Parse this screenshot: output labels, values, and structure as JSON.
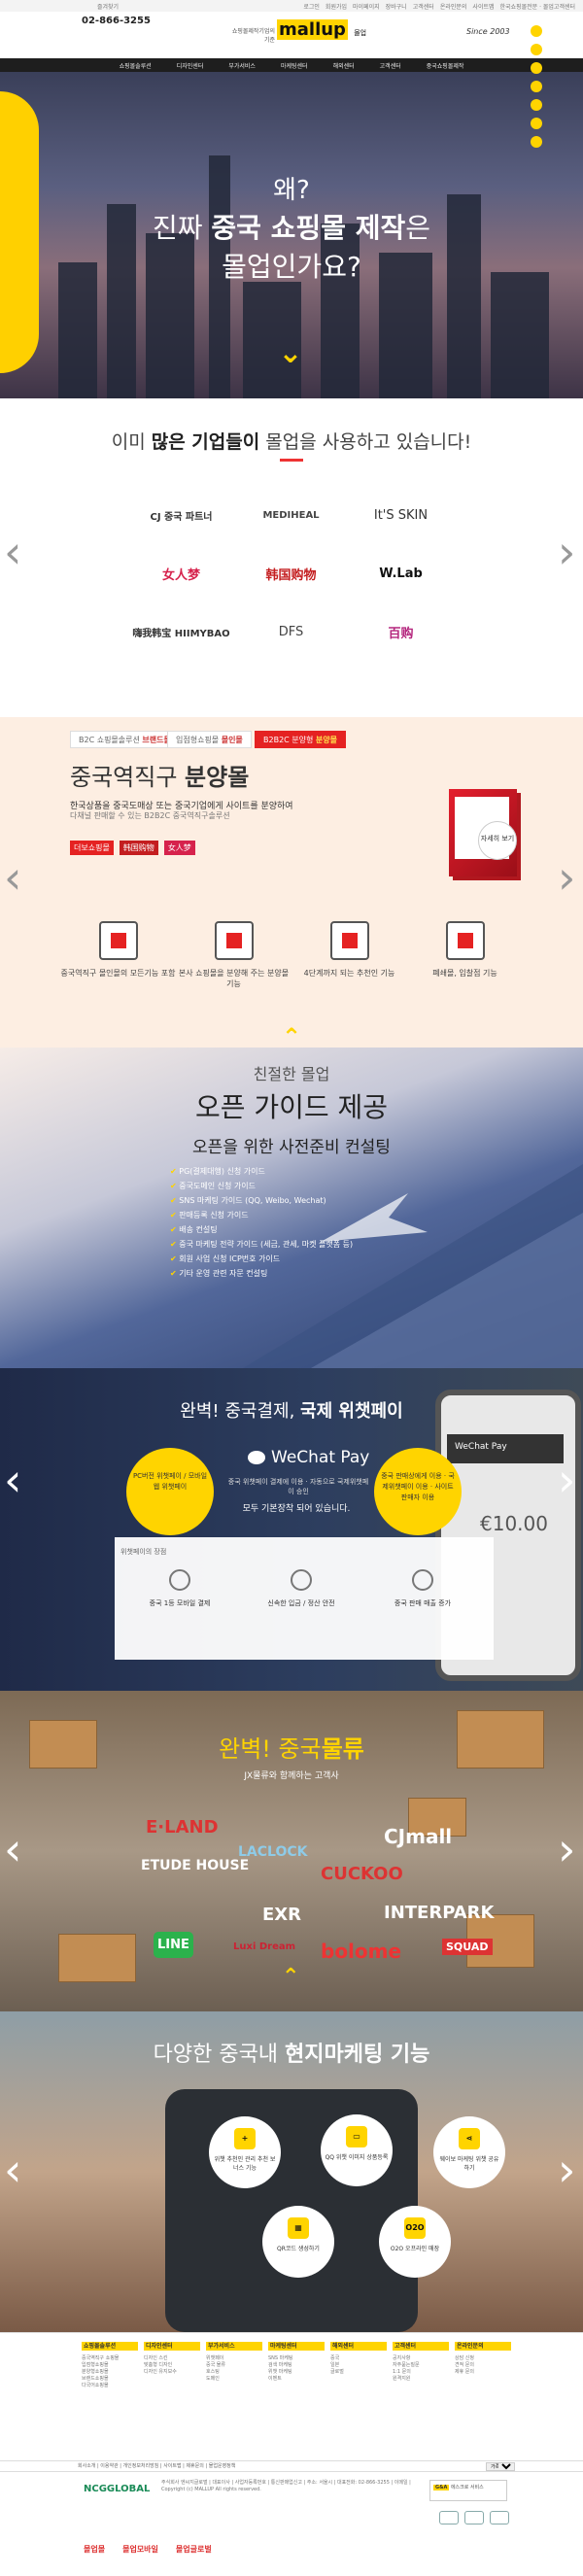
{
  "topbar": {
    "left": "즐겨찾기",
    "links": [
      "로그인",
      "회원가입",
      "마이페이지",
      "장바구니",
      "고객센터",
      "온라인문의",
      "사이트맵"
    ],
    "right": "한국쇼핑몰전문 · 몰업고객센터"
  },
  "header": {
    "phone_label": "02-866-3255",
    "logo_sub": "쇼핑몰제작기업의 기준",
    "logo": "mallup",
    "logo_tag": "몰업",
    "since": "Since 2003"
  },
  "nav": [
    "쇼핑몰솔루션",
    "디자인센터",
    "부가서비스",
    "마케팅센터",
    "해외센터",
    "고객센터",
    "중국쇼핑몰제작"
  ],
  "hero": {
    "line1": "왜?",
    "line2a": "진짜 ",
    "line2b": "중국 쇼핑몰 제작",
    "line2c": "은",
    "line3": "몰업인가요?"
  },
  "partners": {
    "title_a": "이미 ",
    "title_b": "많은 기업들이",
    "title_c": " 몰업을 사용하고 있습니다!",
    "logos": [
      "CJ 중국 파트너",
      "MEDIHEAL",
      "It'S SKIN",
      "女人梦",
      "韩国购物",
      "W.Lab",
      "嗨我韩宝 HIIMYBAO",
      "DFS",
      "百购"
    ]
  },
  "store": {
    "tabs": [
      {
        "a": "B2C 쇼핑몰솔루션 ",
        "b": "브랜드몰"
      },
      {
        "a": "입점형쇼핑몰 ",
        "b": "몰인몰"
      },
      {
        "a": "B2B2C 분양형 ",
        "b": "분양몰"
      }
    ],
    "title_a": "중국역직구 ",
    "title_b": "분양몰",
    "desc1": "한국상품을 중국도매상 또는 중국기업에게 사이트를 분양하여",
    "desc2": "다채널 판매할 수 있는 B2B2C 중국역직구솔루션",
    "tags": [
      "더보쇼핑몰",
      "韩国购物",
      "女人梦"
    ],
    "detail": "자세히 보기",
    "features": [
      "중국역직구 몰인몰의 모든기능 포함",
      "본사 쇼핑몰을 분양해 주는 분양몰 기능",
      "4단계까지 되는 추천인 기능",
      "폐쇄몰, 입찰점 기능"
    ]
  },
  "guide": {
    "sub": "친절한 몰업",
    "title": "오픈 가이드 제공",
    "line": "오픈을 위한 사전준비 컨설팅",
    "items": [
      "PG(결제대행) 신청 가이드",
      "중국도메인 신청 가이드",
      "SNS 마케팅 가이드 (QQ, Weibo, Wechat)",
      "판매등록 신청 가이드",
      "배송 컨설팅",
      "중국 마케팅 전략 가이드 (세금, 관세, 마켓 플랫폼 등)",
      "회원 사업 신청 ICP번호 가이드",
      "기타 운영 관련 자문 컨설팅"
    ]
  },
  "wechat": {
    "title_a": "완벽! 중국결제, ",
    "title_b": "국제 위챗페이",
    "left_circle": "PC버전 위챗페이 / 모바일 웹 위챗페이",
    "right_circle": "중국 판매상에게 이용 · 국제위챗페이 이용 · 사이트판매자 이용",
    "logo": "WeChat Pay",
    "tx1": "중국 위챗페이 결제에 이용 · 자동으로 국제위챗페이 승인",
    "tx2": "모두 기본장착 되어 있습니다.",
    "box_label": "위챗페이의 장점",
    "benefits": [
      "중국 1등 모바일 결제",
      "신속한 입금 / 정산 안전",
      "중국 판매 매출 증가"
    ],
    "phone_bar": "WeChat Pay",
    "phone_amount": "€10.00"
  },
  "logistics": {
    "title_a": "완벽! 중국",
    "title_b": "물류",
    "sub": "JX물류와 함께하는 고객사",
    "brands": [
      "E·LAND",
      "ETUDE HOUSE",
      "LACLOCK",
      "CJmall",
      "CUCKOO",
      "EXR",
      "INTERPARK",
      "LINE",
      "Luxi Dream",
      "bolome",
      "SQUAD"
    ]
  },
  "marketing": {
    "title_a": "다양한 중국내 ",
    "title_b": "현지마케팅 기능",
    "items": [
      "위챗 추천인 관리 추천 보너스 기능",
      "QQ 위챗 이미지 상품등록",
      "웨이보 마케팅 위챗 공유하기",
      "QR코드 생성하기",
      "O2O 오프라인 매장"
    ]
  },
  "footer": {
    "columns": [
      {
        "head": "쇼핑몰솔루션",
        "items": [
          "중국역직구 쇼핑몰",
          "입점형쇼핑몰",
          "분양형쇼핑몰",
          "브랜드쇼핑몰",
          "다국어쇼핑몰"
        ]
      },
      {
        "head": "디자인센터",
        "items": [
          "디자인 스킨",
          "맞춤형 디자인",
          "디자인 유지보수"
        ]
      },
      {
        "head": "부가서비스",
        "items": [
          "위챗페이",
          "중국 물류",
          "호스팅",
          "도메인"
        ]
      },
      {
        "head": "마케팅센터",
        "items": [
          "SNS 마케팅",
          "검색 마케팅",
          "위챗 마케팅",
          "이벤트"
        ]
      },
      {
        "head": "해외센터",
        "items": [
          "중국",
          "일본",
          "글로벌"
        ]
      },
      {
        "head": "고객센터",
        "items": [
          "공지사항",
          "자주묻는질문",
          "1:1 문의",
          "원격지원"
        ]
      },
      {
        "head": "온라인문의",
        "items": [
          "상담 신청",
          "견적 문의",
          "제휴 문의"
        ]
      }
    ],
    "bar_links": "회사소개 | 이용약관 | 개인정보처리방침 | 사이트맵 | 제휴문의 | 몰업운영정책",
    "select": "가족",
    "logo": "NCGGLOBAL",
    "info": "주식회사 엔씨지글로벌 | 대표이사 | 사업자등록번호 | 통신판매업신고 | 주소: 서울시 | 대표전화: 02-866-3255 | 이메일 | Copyright (c) MALLUP All rights reserved.",
    "badge_a": "G&A",
    "badge_b": "에스크로 서비스",
    "bottom": [
      "몰업몰",
      "몰업모바일",
      "몰업글로벌"
    ]
  },
  "colors": {
    "accent": "#ffd400",
    "red": "#e52222",
    "dark": "#1e1e1e"
  }
}
